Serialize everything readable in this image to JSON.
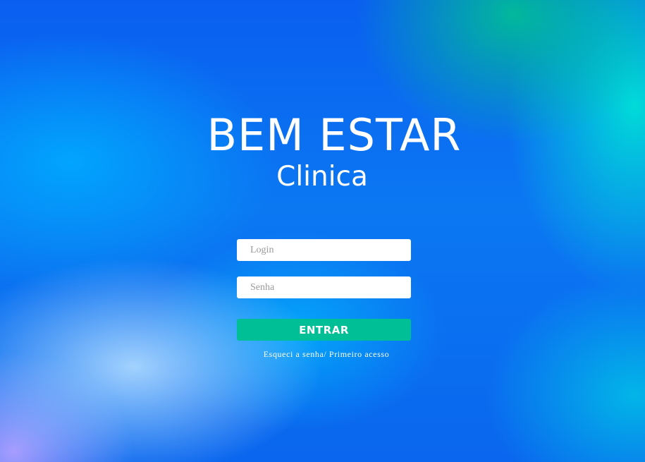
{
  "brand": {
    "title": "BEM ESTAR",
    "subtitle": "Clinica"
  },
  "login_form": {
    "login_placeholder": "Login",
    "login_value": "",
    "password_placeholder": "Senha",
    "password_value": "",
    "submit_label": "ENTRAR",
    "forgot_link": "Esqueci a senha/ Primeiro acesso"
  },
  "colors": {
    "button_accent": "#00bf96",
    "text_on_background": "#ffffff",
    "background_primary": "#0a66ee"
  }
}
